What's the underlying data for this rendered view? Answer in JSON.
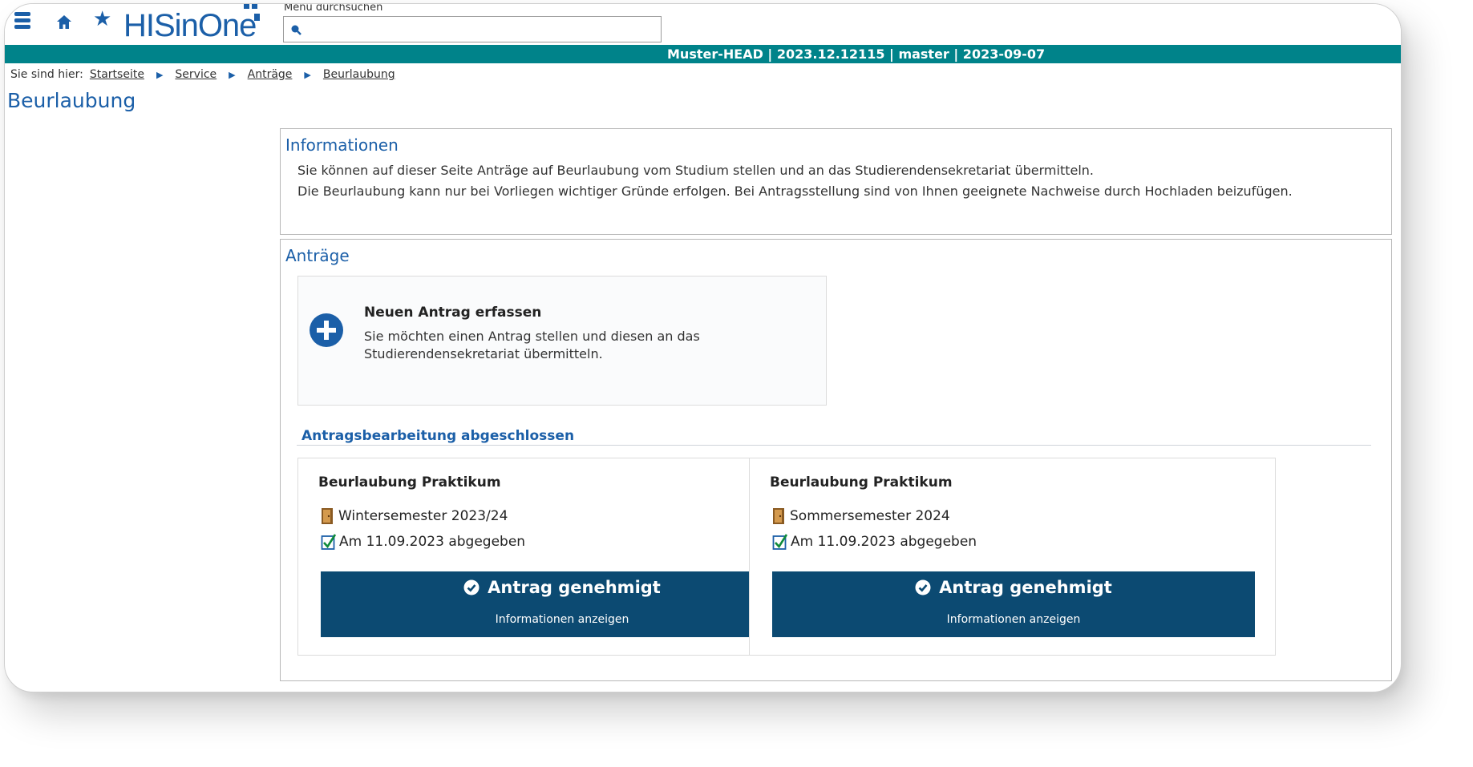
{
  "header": {
    "logo_text": "HISinOne",
    "search_label": "Menü durchsuchen",
    "search_value": "",
    "status_text": "Muster-HEAD | 2023.12.12115 | master | 2023-09-07"
  },
  "breadcrumb": {
    "prefix": "Sie sind hier:",
    "items": [
      "Startseite",
      "Service",
      "Anträge",
      "Beurlaubung"
    ]
  },
  "page": {
    "title": "Beurlaubung"
  },
  "info": {
    "title": "Informationen",
    "lines": [
      "Sie können auf dieser Seite Anträge auf Beurlaubung vom Studium stellen und an das Studierendensekretariat übermitteln.",
      "Die Beurlaubung kann nur bei Vorliegen wichtiger Gründe erfolgen. Bei Antragsstellung sind von Ihnen geeignete Nachweise durch Hochladen beizufügen."
    ]
  },
  "antraege": {
    "title": "Anträge",
    "new_request": {
      "title": "Neuen Antrag erfassen",
      "description": "Sie möchten einen Antrag stellen und diesen an das Studierendensekretariat übermitteln."
    },
    "section_title": "Antragsbearbeitung abgeschlossen",
    "requests": [
      {
        "title": "Beurlaubung Praktikum",
        "semester": "Wintersemester 2023/24",
        "submitted": "Am 11.09.2023 abgegeben",
        "status": "Antrag genehmigt",
        "action": "Informationen anzeigen"
      },
      {
        "title": "Beurlaubung Praktikum",
        "semester": "Sommersemester 2024",
        "submitted": "Am 11.09.2023 abgegeben",
        "status": "Antrag genehmigt",
        "action": "Informationen anzeigen"
      }
    ]
  },
  "colors": {
    "brand_blue": "#1b5fa8",
    "status_bar": "#00838a",
    "button_dark": "#0c4a72"
  }
}
